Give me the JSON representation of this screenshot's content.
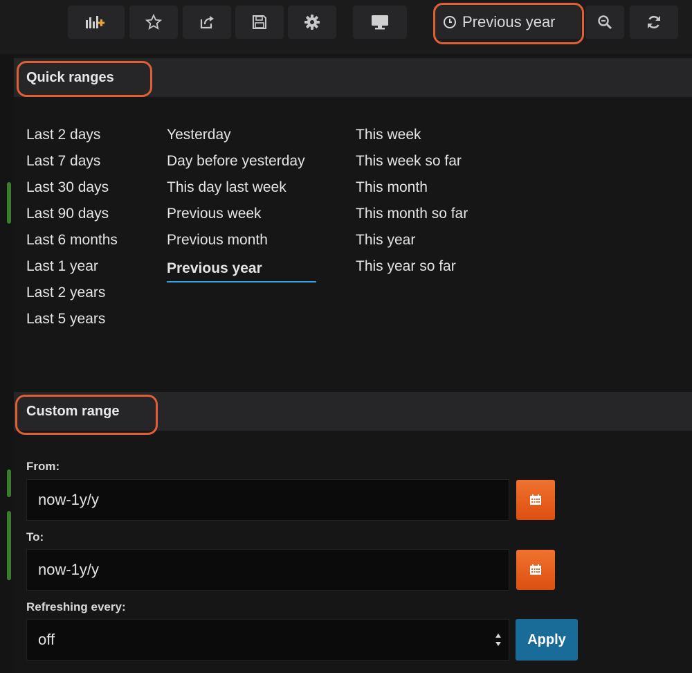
{
  "navbar": {
    "time_picker_label": "Previous year",
    "icons": [
      "add-panel-icon",
      "star-icon",
      "share-icon",
      "save-icon",
      "gear-icon",
      "monitor-icon",
      "clock-icon",
      "zoom-out-icon",
      "refresh-icon"
    ],
    "highlight_color": "#e05f34"
  },
  "quick_ranges": {
    "title": "Quick ranges",
    "columns": [
      [
        "Last 2 days",
        "Last 7 days",
        "Last 30 days",
        "Last 90 days",
        "Last 6 months",
        "Last 1 year",
        "Last 2 years",
        "Last 5 years"
      ],
      [
        "Yesterday",
        "Day before yesterday",
        "This day last week",
        "Previous week",
        "Previous month",
        "Previous year"
      ],
      [
        "This week",
        "This week so far",
        "This month",
        "This month so far",
        "This year",
        "This year so far"
      ]
    ],
    "active": "Previous year",
    "active_color": "#33a2e5"
  },
  "custom_range": {
    "title": "Custom range",
    "from_label": "From:",
    "from_value": "now-1y/y",
    "to_label": "To:",
    "to_value": "now-1y/y",
    "refresh_label": "Refreshing every:",
    "refresh_value": "off",
    "apply_label": "Apply",
    "calendar_color": "#e8621f",
    "apply_color": "#1a6c98"
  }
}
